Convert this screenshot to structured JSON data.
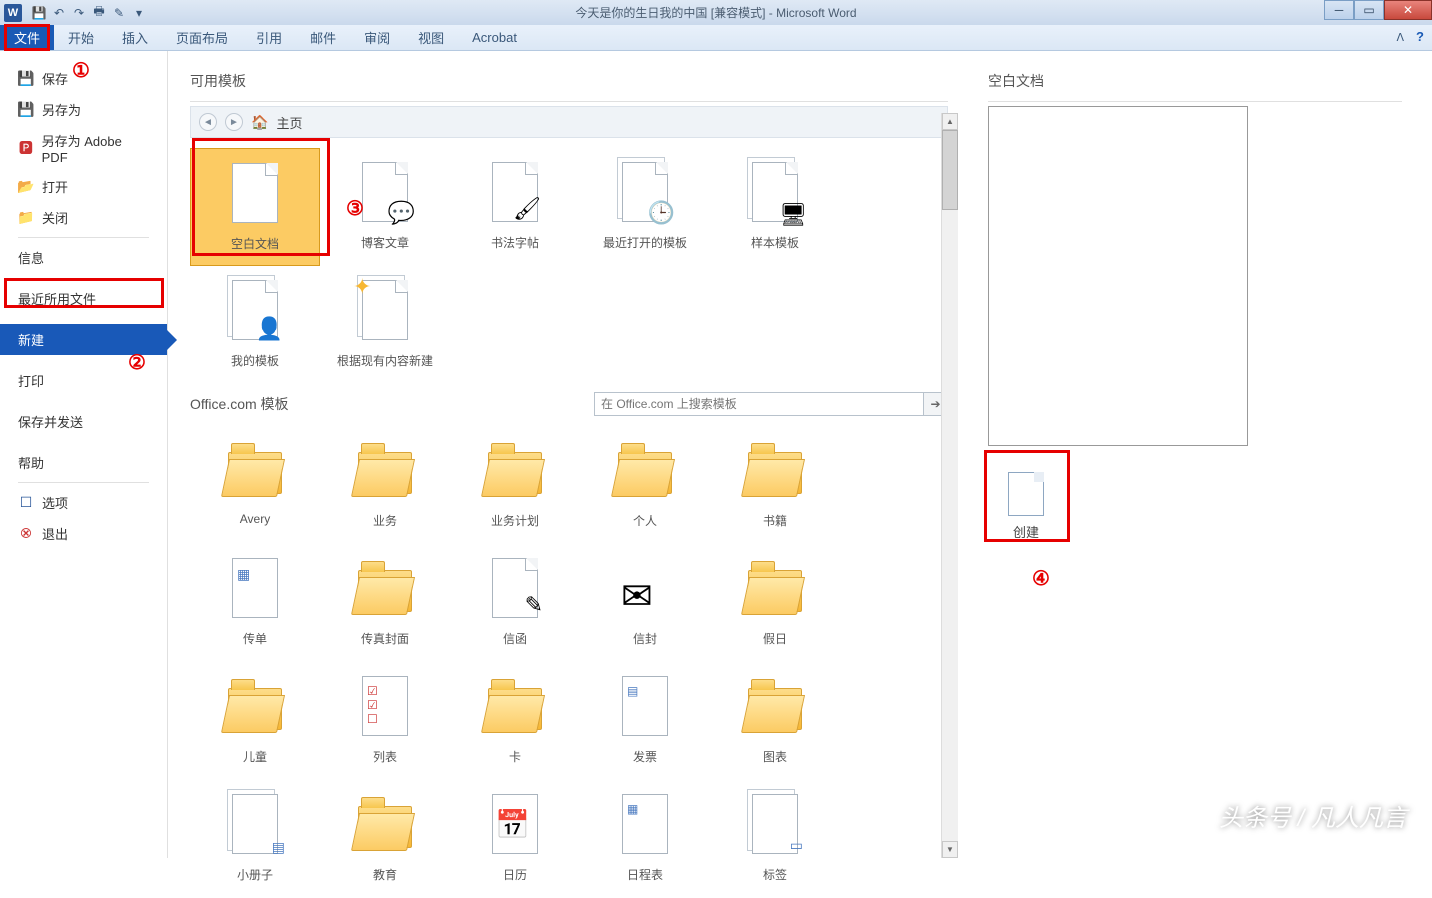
{
  "title": "今天是你的生日我的中国 [兼容模式] - Microsoft Word",
  "ribbon": [
    "文件",
    "开始",
    "插入",
    "页面布局",
    "引用",
    "邮件",
    "审阅",
    "视图",
    "Acrobat"
  ],
  "sidebar": {
    "save": "保存",
    "saveas": "另存为",
    "saveas_pdf": "另存为 Adobe PDF",
    "open": "打开",
    "close": "关闭",
    "info": "信息",
    "recent": "最近所用文件",
    "new": "新建",
    "print": "打印",
    "saveSend": "保存并发送",
    "help": "帮助",
    "options": "选项",
    "exit": "退出"
  },
  "templates": {
    "heading": "可用模板",
    "home": "主页",
    "row1": [
      "空白文档",
      "博客文章",
      "书法字帖",
      "最近打开的模板",
      "样本模板"
    ],
    "row2": [
      "我的模板",
      "根据现有内容新建"
    ],
    "officeHeading": "Office.com 模板",
    "searchPlaceholder": "在 Office.com 上搜索模板",
    "cats1": [
      "Avery",
      "业务",
      "业务计划",
      "个人",
      "书籍"
    ],
    "cats2": [
      "传单",
      "传真封面",
      "信函",
      "信封",
      "假日"
    ],
    "cats3": [
      "儿童",
      "列表",
      "卡",
      "发票",
      "图表"
    ],
    "cats4": [
      "小册子",
      "教育",
      "日历",
      "日程表",
      "标签"
    ]
  },
  "preview": {
    "title": "空白文档",
    "create": "创建"
  },
  "annotations": {
    "c1": "①",
    "c2": "②",
    "c3": "③",
    "c4": "④"
  },
  "watermark": "头条号 / 凡人凡言"
}
